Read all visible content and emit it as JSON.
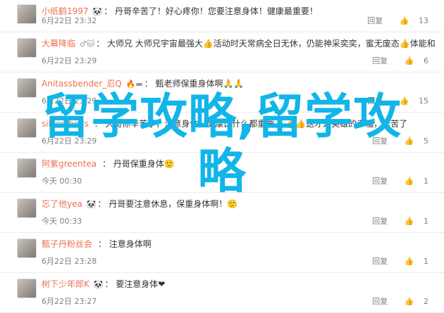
{
  "comments": [
    {
      "name": "小纸鹤1997",
      "badges": "🐼",
      "text": "丹哥辛苦了！好心疼你！您要注意身体！健康最重要！",
      "time": "6月22日 23:32",
      "reply": "回复",
      "likes": "13"
    },
    {
      "name": "大幕降临",
      "badges": "♂🐱",
      "text": "大师兄 大师兄宇宙最强大👍活动时天常病全日无休，仍能神采奕奕，蜜无废态👍体能和精神让人都羡慕啊😊",
      "time": "6月22日 23:29",
      "reply": "回复",
      "likes": "6"
    },
    {
      "name": "Anitassbender_忍Q",
      "badges": "🔥▬",
      "text": "甄老师保重身体啊🙏🙏",
      "time": "6月22日 23:29",
      "reply": "回复",
      "likes": "15"
    },
    {
      "name": "silver_boys",
      "badges": "",
      "text": "大哥你辛苦了，注意身体，健康比什么都重要👍👍👍这才是英雄的幸福，辛苦了",
      "time": "6月22日 23:29",
      "reply": "回复",
      "likes": "5"
    },
    {
      "name": "阿紫greentea",
      "badges": "",
      "text": "丹哥保重身体🙂",
      "time": "今天 00:30",
      "reply": "回复",
      "likes": "1"
    },
    {
      "name": "忘了他yea",
      "badges": "🐼",
      "text": "丹哥要注意休息，保重身体啊！🙁",
      "time": "今天 00:33",
      "reply": "回复",
      "likes": "1"
    },
    {
      "name": "甄子丹粉丝会",
      "badges": "",
      "text": "注意身体啊",
      "time": "6月22日 23:28",
      "reply": "回复",
      "likes": "1"
    },
    {
      "name": "树下少年郎K",
      "badges": "🐼",
      "text": "要注意身体❤",
      "time": "6月22日 23:27",
      "reply": "回复",
      "likes": "2"
    }
  ],
  "watermark": {
    "line1": "留学攻略,留学攻",
    "line2": "略"
  }
}
